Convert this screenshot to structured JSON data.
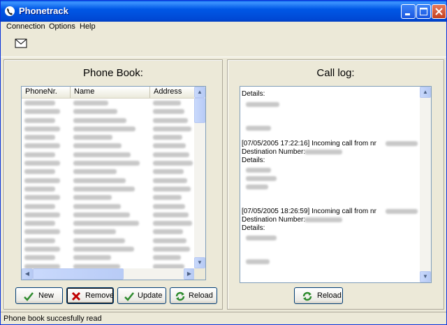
{
  "window": {
    "title": "Phonetrack"
  },
  "menu": {
    "items": [
      "Connection",
      "Options",
      "Help"
    ]
  },
  "phonebook": {
    "title": "Phone Book:",
    "columns": [
      "PhoneNr.",
      "Name",
      "Address"
    ],
    "row_count": 20
  },
  "calllog": {
    "title": "Call log:",
    "lines": [
      {
        "text": "Details:",
        "blurred": false
      },
      {
        "text": "",
        "blurred": true
      },
      {
        "text": "",
        "blurred": true
      },
      {
        "text": "[07/05/2005 17:22:16] Incoming call from nr",
        "blurred": false
      },
      {
        "text": "Destination Number:",
        "blurred": false
      },
      {
        "text": "Details:",
        "blurred": false
      },
      {
        "text": "",
        "blurred": true
      },
      {
        "text": "",
        "blurred": true
      },
      {
        "text": "",
        "blurred": true
      },
      {
        "text": "[07/05/2005 18:26:59] Incoming call from nr",
        "blurred": false
      },
      {
        "text": "Destination Number:",
        "blurred": false
      },
      {
        "text": "Details:",
        "blurred": false
      },
      {
        "text": "",
        "blurred": true
      },
      {
        "text": "",
        "blurred": true
      }
    ]
  },
  "buttons": {
    "new": "New",
    "remove": "Remove",
    "update": "Update",
    "reload_phonebook": "Reload",
    "reload_calllog": "Reload"
  },
  "status": {
    "text": "Phone book succesfully read"
  },
  "colors": {
    "title_blue": "#0058E6",
    "close_red": "#C4401F",
    "check_green": "#2E8B2E",
    "remove_red": "#C00000"
  }
}
